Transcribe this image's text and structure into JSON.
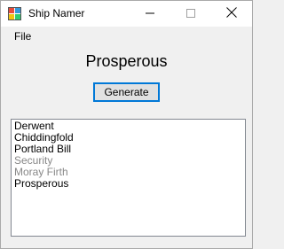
{
  "window": {
    "title": "Ship Namer"
  },
  "menu": {
    "file": "File"
  },
  "result": {
    "name": "Prosperous"
  },
  "generate": {
    "label": "Generate"
  },
  "history": {
    "items": [
      "Derwent",
      "Chiddingfold",
      "Portland Bill",
      "Security",
      "Moray Firth",
      "Prosperous"
    ]
  },
  "colors": {
    "accent": "#0078d7",
    "background": "#f0f0f0",
    "list_border": "#828790"
  },
  "icons": {
    "app": "app-window-icon",
    "minimize": "minimize-icon",
    "maximize": "maximize-icon",
    "close": "close-icon"
  }
}
